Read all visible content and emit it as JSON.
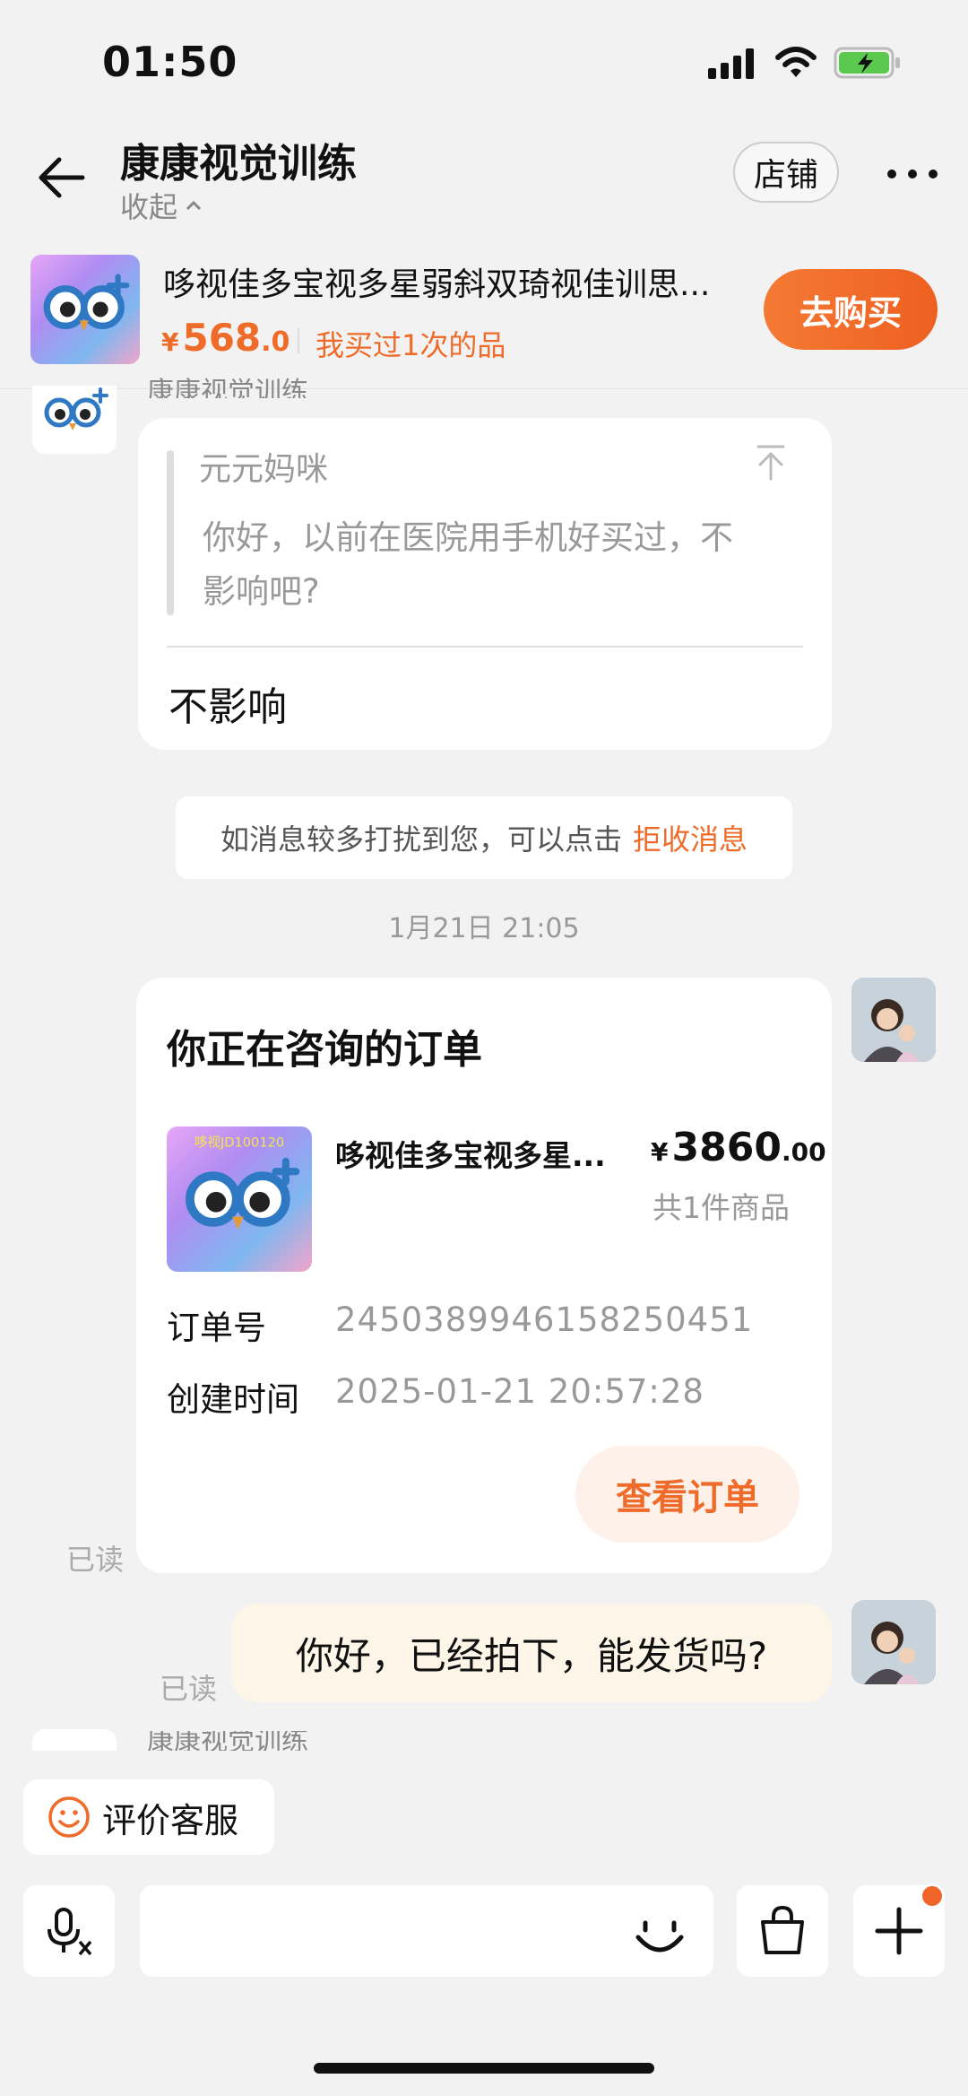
{
  "status": {
    "time": "01:50"
  },
  "header": {
    "title": "康康视觉训练",
    "collapse_label": "收起",
    "shop_label": "店铺"
  },
  "product": {
    "title": "哆视佳多宝视多星弱斜双琦视佳训思...",
    "price_currency": "¥",
    "price_int": "568",
    "price_dec": ".0",
    "bought": "我买过1次的品",
    "buy_label": "去购买"
  },
  "chat": {
    "shop_sender": "康康视觉训练",
    "quote_name": "元元妈咪",
    "quote_text": "你好，以前在医院用手机好买过，不影响吧?",
    "reply_text": "不影响",
    "notice_text": "如消息较多打扰到您，可以点击",
    "notice_link": "拒收消息",
    "timestamp": "1月21日 21:05",
    "read_label": "已读",
    "my_message": "你好，已经拍下，能发货吗?"
  },
  "order": {
    "heading": "你正在咨询的订单",
    "product_name": "哆视佳多宝视多星...",
    "price_currency": "¥",
    "price_int": "3860",
    "price_dec": ".00",
    "count": "共1件商品",
    "order_no_label": "订单号",
    "order_no": "2450389946158250451",
    "created_label": "创建时间",
    "created_value": "2025-01-21 20:57:28",
    "view_label": "查看订单",
    "thumb_badge": "哆视JD100120"
  },
  "bottom": {
    "rate_label": "评价客服"
  },
  "colors": {
    "accent": "#ee6b2a",
    "background": "#f2f2f2",
    "my_bubble": "#fdf6e8"
  },
  "icons": [
    "back-arrow-icon",
    "more-icon",
    "pin-top-icon",
    "smile-icon",
    "voice-icon",
    "emoji-icon",
    "bag-icon",
    "plus-icon"
  ]
}
